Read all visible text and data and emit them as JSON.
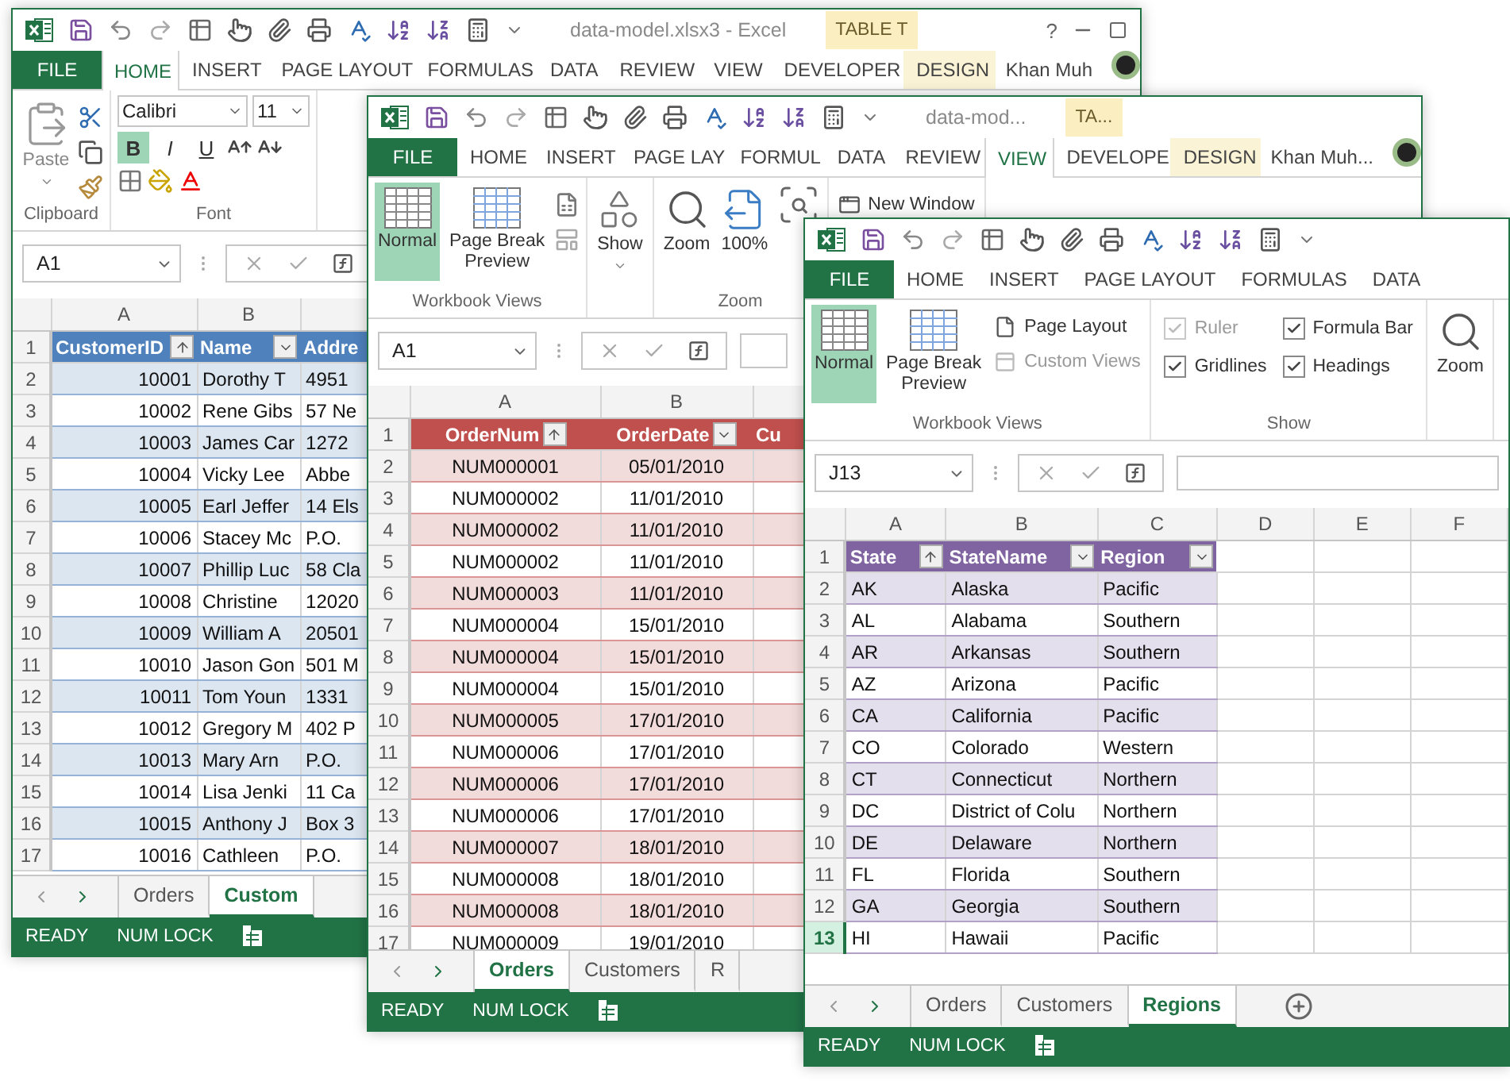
{
  "windows": [
    {
      "title": "data-model.xlsx3 - Excel",
      "context_label": "TABLE T",
      "help": "?",
      "window_buttons": true,
      "account": "Khan Muh",
      "tabs": [
        {
          "label": "FILE",
          "kind": "file",
          "selected": false
        },
        {
          "label": "HOME",
          "kind": "tab",
          "selected": true
        },
        {
          "label": "INSERT",
          "kind": "tab",
          "selected": false
        },
        {
          "label": "PAGE LAYOUT",
          "kind": "tab",
          "selected": false
        },
        {
          "label": "FORMULAS",
          "kind": "tab",
          "selected": false
        },
        {
          "label": "DATA",
          "kind": "tab",
          "selected": false
        },
        {
          "label": "REVIEW",
          "kind": "tab",
          "selected": false
        },
        {
          "label": "VIEW",
          "kind": "tab",
          "selected": false
        },
        {
          "label": "DEVELOPER",
          "kind": "tab",
          "selected": false
        },
        {
          "label": "DESIGN",
          "kind": "context",
          "selected": false
        }
      ],
      "ribbon_groups": [
        {
          "label": "Clipboard",
          "items": [
            {
              "kind": "paste",
              "label": "Paste",
              "disabled": true
            },
            {
              "kind": "clipboard-tools"
            }
          ]
        },
        {
          "label": "Font",
          "items": [
            {
              "kind": "font-field",
              "value": "Calibri"
            },
            {
              "kind": "font-field",
              "value": "11"
            },
            {
              "kind": "format",
              "label": "B",
              "selected": true
            },
            {
              "kind": "format",
              "label": "I",
              "selected": false
            },
            {
              "kind": "format",
              "label": "U",
              "selected": false
            },
            {
              "kind": "font-tools"
            }
          ]
        }
      ],
      "name_box": "A1",
      "column_headers": [
        "A",
        "B"
      ],
      "table": {
        "header": {
          "num": "1",
          "cells": [
            {
              "label": "CustomerID",
              "filter_button": true,
              "sorted": true
            },
            {
              "label": "Name",
              "filter_button": true,
              "sorted": false
            },
            {
              "label": "Addre"
            }
          ]
        },
        "rows": [
          {
            "num": "2",
            "cells": [
              "10001",
              "Dorothy T",
              "4951"
            ],
            "selected": false
          },
          {
            "num": "3",
            "cells": [
              "10002",
              "Rene Gibs",
              "57 Ne"
            ],
            "selected": false
          },
          {
            "num": "4",
            "cells": [
              "10003",
              "James Car",
              "1272"
            ],
            "selected": false
          },
          {
            "num": "5",
            "cells": [
              "10004",
              "Vicky Lee",
              "Abbe"
            ],
            "selected": false
          },
          {
            "num": "6",
            "cells": [
              "10005",
              "Earl Jeffer",
              "14 Els"
            ],
            "selected": false
          },
          {
            "num": "7",
            "cells": [
              "10006",
              "Stacey Mc",
              "P.O."
            ],
            "selected": false
          },
          {
            "num": "8",
            "cells": [
              "10007",
              "Phillip Luc",
              "58 Cla"
            ],
            "selected": false
          },
          {
            "num": "9",
            "cells": [
              "10008",
              "Christine",
              "12020"
            ],
            "selected": false
          },
          {
            "num": "10",
            "cells": [
              "10009",
              "William A",
              "20501"
            ],
            "selected": false
          },
          {
            "num": "11",
            "cells": [
              "10010",
              "Jason Gon",
              "501 M"
            ],
            "selected": false
          },
          {
            "num": "12",
            "cells": [
              "10011",
              "Tom Youn",
              "1331"
            ],
            "selected": false
          },
          {
            "num": "13",
            "cells": [
              "10012",
              "Gregory M",
              "402 P"
            ],
            "selected": false
          },
          {
            "num": "14",
            "cells": [
              "10013",
              "Mary Arn",
              "P.O."
            ],
            "selected": false
          },
          {
            "num": "15",
            "cells": [
              "10014",
              "Lisa Jenki",
              "11 Ca"
            ],
            "selected": false
          },
          {
            "num": "16",
            "cells": [
              "10015",
              "Anthony J",
              "Box 3"
            ],
            "selected": false
          },
          {
            "num": "17",
            "cells": [
              "10016",
              "Cathleen",
              "P.O."
            ],
            "selected": false
          }
        ]
      },
      "sheet_tabs": [
        {
          "label": "Orders",
          "selected": false
        },
        {
          "label": "Custom",
          "selected": true
        }
      ],
      "status": [
        "READY",
        "NUM LOCK"
      ]
    },
    {
      "title": "data-mod...",
      "context_label": "TA...",
      "account": "Khan Muh...",
      "tabs": [
        {
          "label": "FILE",
          "kind": "file",
          "selected": false
        },
        {
          "label": "HOME",
          "kind": "tab",
          "selected": false
        },
        {
          "label": "INSERT",
          "kind": "tab",
          "selected": false
        },
        {
          "label": "PAGE LAY",
          "kind": "tab",
          "selected": false
        },
        {
          "label": "FORMUL",
          "kind": "tab",
          "selected": false
        },
        {
          "label": "DATA",
          "kind": "tab",
          "selected": false
        },
        {
          "label": "REVIEW",
          "kind": "tab",
          "selected": false
        },
        {
          "label": "VIEW",
          "kind": "tab",
          "selected": true
        },
        {
          "label": "DEVELOPE",
          "kind": "tab",
          "selected": false
        },
        {
          "label": "DESIGN",
          "kind": "context",
          "selected": false
        }
      ],
      "ribbon_groups": [
        {
          "label": "Workbook Views",
          "items": [
            {
              "kind": "normal-view",
              "label": "Normal",
              "selected": true
            },
            {
              "kind": "page-break",
              "label": "Page Break Preview",
              "selected": false
            },
            {
              "kind": "mini-views"
            }
          ]
        },
        {
          "items": [
            {
              "kind": "show",
              "label": "Show"
            }
          ]
        },
        {
          "label": "Zoom",
          "items": [
            {
              "kind": "zoom",
              "label": "Zoom"
            },
            {
              "kind": "zoom-100",
              "label": "100%"
            },
            {
              "kind": "zoom-selection"
            }
          ]
        },
        {
          "items": [
            {
              "kind": "new-window",
              "label": "New Window"
            }
          ]
        }
      ],
      "name_box": "A1",
      "column_headers": [
        "A",
        "B"
      ],
      "table": {
        "header": {
          "num": "1",
          "cells": [
            {
              "label": "OrderNum",
              "filter_button": true,
              "sorted": true
            },
            {
              "label": "OrderDate",
              "filter_button": true,
              "sorted": false
            },
            {
              "label": "Cu"
            }
          ]
        },
        "rows": [
          {
            "num": "2",
            "cells": [
              "NUM000001",
              "05/01/2010"
            ],
            "selected": false
          },
          {
            "num": "3",
            "cells": [
              "NUM000002",
              "11/01/2010"
            ],
            "selected": false
          },
          {
            "num": "4",
            "cells": [
              "NUM000002",
              "11/01/2010"
            ],
            "selected": false
          },
          {
            "num": "5",
            "cells": [
              "NUM000002",
              "11/01/2010"
            ],
            "selected": false
          },
          {
            "num": "6",
            "cells": [
              "NUM000003",
              "11/01/2010"
            ],
            "selected": false
          },
          {
            "num": "7",
            "cells": [
              "NUM000004",
              "15/01/2010"
            ],
            "selected": false
          },
          {
            "num": "8",
            "cells": [
              "NUM000004",
              "15/01/2010"
            ],
            "selected": false
          },
          {
            "num": "9",
            "cells": [
              "NUM000004",
              "15/01/2010"
            ],
            "selected": false
          },
          {
            "num": "10",
            "cells": [
              "NUM000005",
              "17/01/2010"
            ],
            "selected": false
          },
          {
            "num": "11",
            "cells": [
              "NUM000006",
              "17/01/2010"
            ],
            "selected": false
          },
          {
            "num": "12",
            "cells": [
              "NUM000006",
              "17/01/2010"
            ],
            "selected": false
          },
          {
            "num": "13",
            "cells": [
              "NUM000006",
              "17/01/2010"
            ],
            "selected": false
          },
          {
            "num": "14",
            "cells": [
              "NUM000007",
              "18/01/2010"
            ],
            "selected": false
          },
          {
            "num": "15",
            "cells": [
              "NUM000008",
              "18/01/2010"
            ],
            "selected": false
          },
          {
            "num": "16",
            "cells": [
              "NUM000008",
              "18/01/2010"
            ],
            "selected": false
          },
          {
            "num": "17",
            "cells": [
              "NUM000009",
              "19/01/2010"
            ],
            "selected": false
          }
        ]
      },
      "sheet_tabs": [
        {
          "label": "Orders",
          "selected": true
        },
        {
          "label": "Customers",
          "selected": false
        },
        {
          "label": "R",
          "selected": false
        }
      ],
      "status": [
        "READY",
        "NUM LOCK"
      ]
    },
    {
      "tabs": [
        {
          "label": "FILE",
          "kind": "file",
          "selected": false
        },
        {
          "label": "HOME",
          "kind": "tab",
          "selected": false
        },
        {
          "label": "INSERT",
          "kind": "tab",
          "selected": false
        },
        {
          "label": "PAGE LAYOUT",
          "kind": "tab",
          "selected": false
        },
        {
          "label": "FORMULAS",
          "kind": "tab",
          "selected": false
        },
        {
          "label": "DATA",
          "kind": "tab",
          "selected": false
        }
      ],
      "ribbon_groups": [
        {
          "label": "Workbook Views",
          "items": [
            {
              "kind": "normal-view",
              "label": "Normal",
              "selected": true
            },
            {
              "kind": "page-break",
              "label": "Page Break Preview",
              "selected": false
            },
            {
              "kind": "page-layout",
              "label": "Page Layout",
              "disabled": false
            },
            {
              "kind": "custom-views",
              "label": "Custom Views",
              "disabled": true
            }
          ]
        },
        {
          "label": "Show",
          "items": [
            {
              "kind": "check",
              "label": "Ruler",
              "checked": true,
              "disabled": true
            },
            {
              "kind": "check",
              "label": "Gridlines",
              "checked": true,
              "disabled": false
            },
            {
              "kind": "check",
              "label": "Formula Bar",
              "checked": true,
              "disabled": false
            },
            {
              "kind": "check",
              "label": "Headings",
              "checked": true,
              "disabled": false
            }
          ]
        },
        {
          "items": [
            {
              "kind": "zoom",
              "label": "Zoom"
            }
          ]
        }
      ],
      "name_box": "J13",
      "column_headers": [
        "A",
        "B",
        "C",
        "D",
        "E",
        "F"
      ],
      "table": {
        "header": {
          "num": "1",
          "cells": [
            {
              "label": "State",
              "filter_button": true,
              "sorted": true
            },
            {
              "label": "StateName",
              "filter_button": true,
              "sorted": false
            },
            {
              "label": "Region",
              "filter_button": true,
              "sorted": false
            }
          ]
        },
        "rows": [
          {
            "num": "2",
            "cells": [
              "AK",
              "Alaska",
              "Pacific"
            ],
            "selected": false
          },
          {
            "num": "3",
            "cells": [
              "AL",
              "Alabama",
              "Southern"
            ],
            "selected": false
          },
          {
            "num": "4",
            "cells": [
              "AR",
              "Arkansas",
              "Southern"
            ],
            "selected": false
          },
          {
            "num": "5",
            "cells": [
              "AZ",
              "Arizona",
              "Pacific"
            ],
            "selected": false
          },
          {
            "num": "6",
            "cells": [
              "CA",
              "California",
              "Pacific"
            ],
            "selected": false
          },
          {
            "num": "7",
            "cells": [
              "CO",
              "Colorado",
              "Western"
            ],
            "selected": false
          },
          {
            "num": "8",
            "cells": [
              "CT",
              "Connecticut",
              "Northern"
            ],
            "selected": false
          },
          {
            "num": "9",
            "cells": [
              "DC",
              "District of Colu",
              "Northern"
            ],
            "selected": false
          },
          {
            "num": "10",
            "cells": [
              "DE",
              "Delaware",
              "Northern"
            ],
            "selected": false
          },
          {
            "num": "11",
            "cells": [
              "FL",
              "Florida",
              "Southern"
            ],
            "selected": false
          },
          {
            "num": "12",
            "cells": [
              "GA",
              "Georgia",
              "Southern"
            ],
            "selected": false
          },
          {
            "num": "13",
            "cells": [
              "HI",
              "Hawaii",
              "Pacific"
            ],
            "selected": true
          }
        ]
      },
      "sheet_tabs": [
        {
          "label": "Orders",
          "selected": false
        },
        {
          "label": "Customers",
          "selected": false
        },
        {
          "label": "Regions",
          "selected": true
        }
      ],
      "add_sheet": true,
      "status": [
        "READY",
        "NUM LOCK"
      ]
    }
  ]
}
